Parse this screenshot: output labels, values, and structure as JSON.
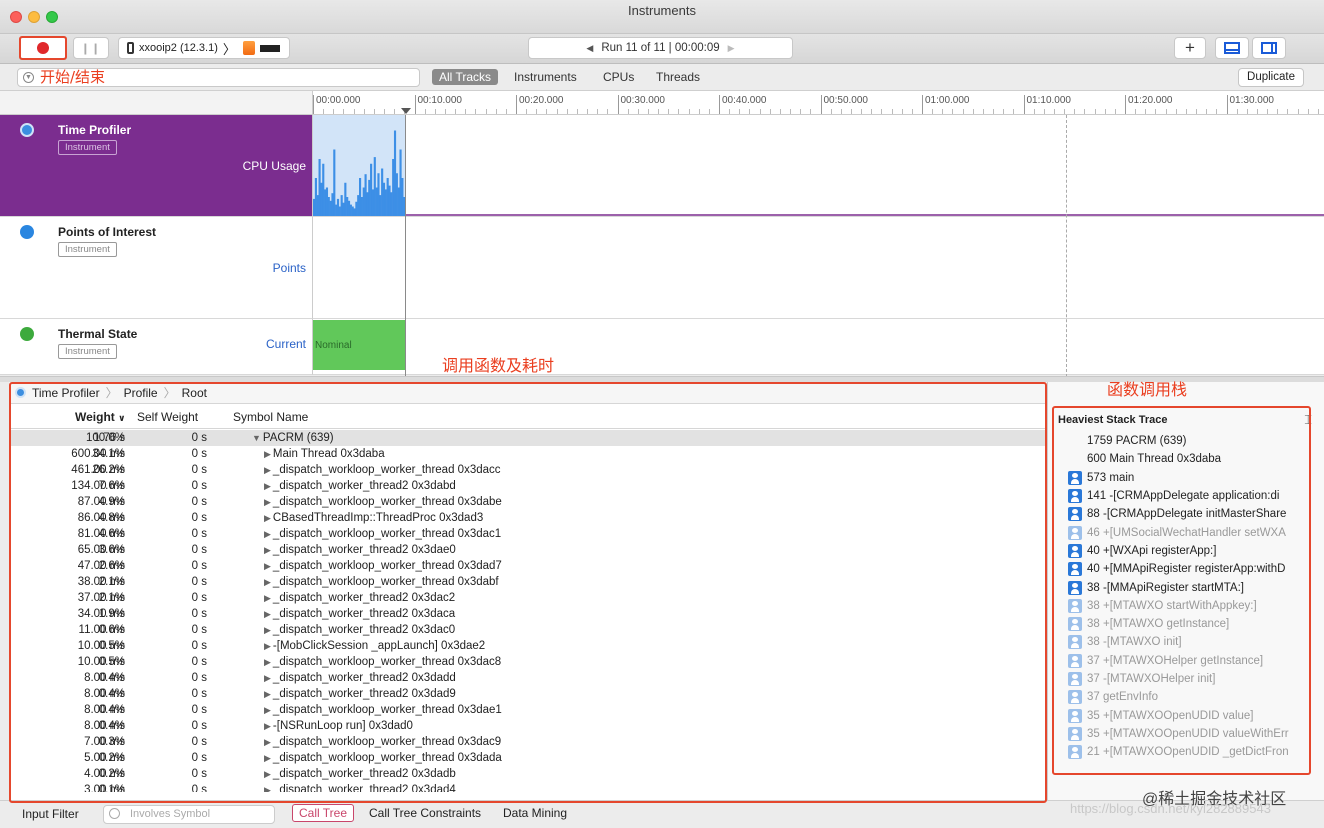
{
  "window": {
    "title": "Instruments"
  },
  "toolbar": {
    "device": "xxooip2 (12.3.1)",
    "run_label": "Run 11 of 11  |  00:00:09",
    "plus": "+"
  },
  "filter": {
    "annotation": "开始/结束",
    "scopes": [
      "All Tracks",
      "Instruments",
      "CPUs",
      "Threads"
    ],
    "duplicate": "Duplicate"
  },
  "ruler": {
    "ticks": [
      "00:00.000",
      "00:10.000",
      "00:20.000",
      "00:30.000",
      "00:40.000",
      "00:50.000",
      "01:00.000",
      "01:10.000",
      "01:20.000",
      "01:30.000"
    ]
  },
  "tracks": [
    {
      "name": "Time Profiler",
      "badge": "Instrument",
      "lane": "CPU Usage",
      "color": "#3b8fe0"
    },
    {
      "name": "Points of Interest",
      "badge": "Instrument",
      "lane": "Points",
      "color": "#2a86e0"
    },
    {
      "name": "Thermal State",
      "badge": "Instrument",
      "lane": "Current",
      "color": "#3daa3d",
      "value": "Nominal"
    }
  ],
  "annotations": {
    "call_tree": "调用函数及耗时",
    "stack": "函数调用栈"
  },
  "breadcrumb": [
    "Time Profiler",
    "Profile",
    "Root"
  ],
  "columns": {
    "weight": "Weight",
    "self_weight": "Self Weight",
    "symbol": "Symbol Name"
  },
  "rows": [
    {
      "w": "1.76 s",
      "p": "100.0%",
      "s": "0 s",
      "n": "PACRM (639)",
      "expanded": true
    },
    {
      "w": "600.00 ms",
      "p": "34.1%",
      "s": "0 s",
      "n": "Main Thread  0x3daba"
    },
    {
      "w": "461.00 ms",
      "p": "26.2%",
      "s": "0 s",
      "n": "_dispatch_workloop_worker_thread  0x3dacc"
    },
    {
      "w": "134.00 ms",
      "p": "7.6%",
      "s": "0 s",
      "n": "_dispatch_worker_thread2  0x3dabd"
    },
    {
      "w": "87.00 ms",
      "p": "4.9%",
      "s": "0 s",
      "n": "_dispatch_workloop_worker_thread  0x3dabe"
    },
    {
      "w": "86.00 ms",
      "p": "4.8%",
      "s": "0 s",
      "n": "CBasedThreadImp::ThreadProc  0x3dad3"
    },
    {
      "w": "81.00 ms",
      "p": "4.6%",
      "s": "0 s",
      "n": "_dispatch_workloop_worker_thread  0x3dac1"
    },
    {
      "w": "65.00 ms",
      "p": "3.6%",
      "s": "0 s",
      "n": "_dispatch_worker_thread2  0x3dae0"
    },
    {
      "w": "47.00 ms",
      "p": "2.6%",
      "s": "0 s",
      "n": "_dispatch_workloop_worker_thread  0x3dad7"
    },
    {
      "w": "38.00 ms",
      "p": "2.1%",
      "s": "0 s",
      "n": "_dispatch_workloop_worker_thread  0x3dabf"
    },
    {
      "w": "37.00 ms",
      "p": "2.1%",
      "s": "0 s",
      "n": "_dispatch_worker_thread2  0x3dac2"
    },
    {
      "w": "34.00 ms",
      "p": "1.9%",
      "s": "0 s",
      "n": "_dispatch_worker_thread2  0x3daca"
    },
    {
      "w": "11.00 ms",
      "p": "0.6%",
      "s": "0 s",
      "n": "_dispatch_worker_thread2  0x3dac0"
    },
    {
      "w": "10.00 ms",
      "p": "0.5%",
      "s": "0 s",
      "n": "-[MobClickSession _appLaunch]  0x3dae2"
    },
    {
      "w": "10.00 ms",
      "p": "0.5%",
      "s": "0 s",
      "n": "_dispatch_workloop_worker_thread  0x3dac8"
    },
    {
      "w": "8.00 ms",
      "p": "0.4%",
      "s": "0 s",
      "n": "_dispatch_worker_thread2  0x3dadd"
    },
    {
      "w": "8.00 ms",
      "p": "0.4%",
      "s": "0 s",
      "n": "_dispatch_worker_thread2  0x3dad9"
    },
    {
      "w": "8.00 ms",
      "p": "0.4%",
      "s": "0 s",
      "n": "_dispatch_workloop_worker_thread  0x3dae1"
    },
    {
      "w": "8.00 ms",
      "p": "0.4%",
      "s": "0 s",
      "n": "-[NSRunLoop run]  0x3dad0"
    },
    {
      "w": "7.00 ms",
      "p": "0.3%",
      "s": "0 s",
      "n": "_dispatch_workloop_worker_thread  0x3dac9"
    },
    {
      "w": "5.00 ms",
      "p": "0.2%",
      "s": "0 s",
      "n": "_dispatch_workloop_worker_thread  0x3dada"
    },
    {
      "w": "4.00 ms",
      "p": "0.2%",
      "s": "0 s",
      "n": "_dispatch_worker_thread2  0x3dadb"
    },
    {
      "w": "3.00 ms",
      "p": "0.1%",
      "s": "0 s",
      "n": "_dispatch_worker_thread2  0x3dad4"
    }
  ],
  "stack": {
    "title": "Heaviest Stack Trace",
    "items": [
      {
        "text": "1759  PACRM (639)",
        "icon": false,
        "dim": false
      },
      {
        "text": "600  Main Thread  0x3daba",
        "icon": false,
        "dim": false
      },
      {
        "text": "573  main",
        "icon": true,
        "dim": false
      },
      {
        "text": "141  -[CRMAppDelegate application:di",
        "icon": true,
        "dim": false
      },
      {
        "text": "88  -[CRMAppDelegate initMasterShare",
        "icon": true,
        "dim": false
      },
      {
        "text": "46  +[UMSocialWechatHandler setWXA",
        "icon": true,
        "dim": true
      },
      {
        "text": "40  +[WXApi registerApp:]",
        "icon": true,
        "dim": false
      },
      {
        "text": "40  +[MMApiRegister registerApp:withD",
        "icon": true,
        "dim": false
      },
      {
        "text": "38  -[MMApiRegister startMTA:]",
        "icon": true,
        "dim": false
      },
      {
        "text": "38  +[MTAWXO startWithAppkey:]",
        "icon": true,
        "dim": true
      },
      {
        "text": "38  +[MTAWXO getInstance]",
        "icon": true,
        "dim": true
      },
      {
        "text": "38  -[MTAWXO init]",
        "icon": true,
        "dim": true
      },
      {
        "text": "37  +[MTAWXOHelper getInstance]",
        "icon": true,
        "dim": true
      },
      {
        "text": "37  -[MTAWXOHelper init]",
        "icon": true,
        "dim": true
      },
      {
        "text": "37  getEnvInfo",
        "icon": true,
        "dim": true
      },
      {
        "text": "35  +[MTAWXOOpenUDID value]",
        "icon": true,
        "dim": true
      },
      {
        "text": "35  +[MTAWXOOpenUDID valueWithErr",
        "icon": true,
        "dim": true
      },
      {
        "text": "21  +[MTAWXOOpenUDID _getDictFron",
        "icon": true,
        "dim": true
      }
    ]
  },
  "bottom": {
    "input_filter": "Input Filter",
    "placeholder": "Involves Symbol",
    "tabs": [
      "Call Tree",
      "Call Tree Constraints",
      "Data Mining"
    ]
  },
  "watermark": "@稀土掘金技术社区",
  "url_watermark": "https://blog.csdn.net/kyl282889543",
  "cpu_samples": [
    18,
    40,
    22,
    60,
    35,
    55,
    28,
    30,
    20,
    16,
    24,
    70,
    12,
    18,
    10,
    22,
    14,
    35,
    20,
    16,
    12,
    10,
    8,
    15,
    22,
    40,
    20,
    30,
    44,
    25,
    38,
    55,
    28,
    62,
    30,
    45,
    22,
    50,
    35,
    28,
    40,
    32,
    25,
    60,
    90,
    45,
    30,
    70,
    40,
    20
  ]
}
